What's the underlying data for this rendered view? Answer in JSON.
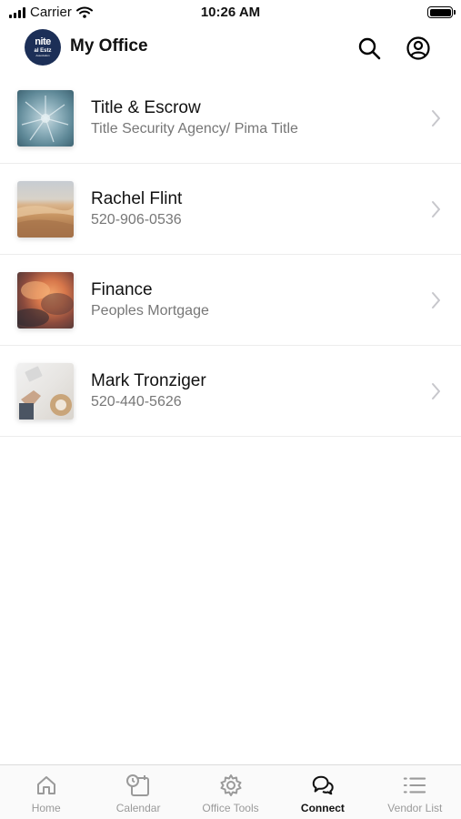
{
  "status_bar": {
    "carrier": "Carrier",
    "time": "10:26 AM",
    "icons": [
      "signal-icon",
      "wifi-icon",
      "battery-icon"
    ]
  },
  "header": {
    "logo": {
      "line1": "nite",
      "line2": "al Estz",
      "line3": "Association"
    },
    "title": "My Office",
    "actions": [
      "search-icon",
      "account-icon"
    ]
  },
  "contacts": [
    {
      "title": "Title & Escrow",
      "subtitle": "Title Security Agency/ Pima Title",
      "image": "agave-photo"
    },
    {
      "title": "Rachel Flint",
      "subtitle": "520-906-0536",
      "image": "desert-photo"
    },
    {
      "title": "Finance",
      "subtitle": "Peoples Mortgage",
      "image": "sunset-clouds-photo"
    },
    {
      "title": "Mark Tronziger",
      "subtitle": "520-440-5626",
      "image": "desk-photo"
    }
  ],
  "tabs": [
    {
      "label": "Home",
      "icon": "home-icon",
      "active": false
    },
    {
      "label": "Calendar",
      "icon": "calendar-icon",
      "active": false
    },
    {
      "label": "Office Tools",
      "icon": "gear-icon",
      "active": false
    },
    {
      "label": "Connect",
      "icon": "chat-icon",
      "active": true
    },
    {
      "label": "Vendor List",
      "icon": "list-icon",
      "active": false
    }
  ],
  "colors": {
    "logo_bg": "#1c2f57",
    "active_tab": "#111111",
    "inactive_tab": "#9a9a9a"
  }
}
